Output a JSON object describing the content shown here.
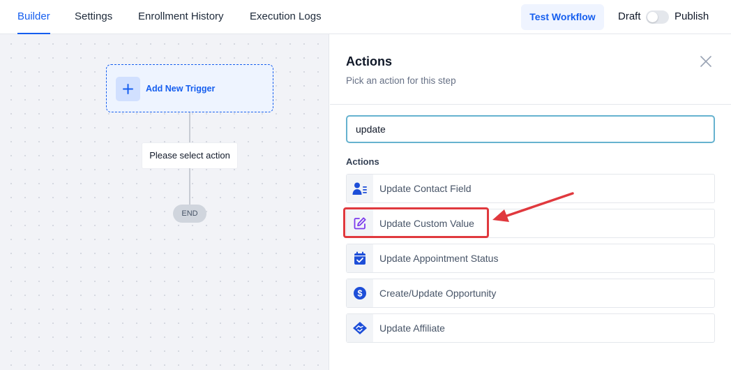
{
  "tabs": {
    "builder": "Builder",
    "settings": "Settings",
    "enrollment_history": "Enrollment History",
    "execution_logs": "Execution Logs"
  },
  "header": {
    "test_workflow": "Test Workflow",
    "draft": "Draft",
    "publish": "Publish",
    "publish_toggle_on": false
  },
  "canvas": {
    "add_trigger": "Add New Trigger",
    "select_action": "Please select action",
    "end": "END"
  },
  "panel": {
    "title": "Actions",
    "subtitle": "Pick an action for this step",
    "search_value": "update",
    "section_label": "Actions",
    "items": [
      {
        "label": "Update Contact Field",
        "icon": "contact-card-icon"
      },
      {
        "label": "Update Custom Value",
        "icon": "edit-pencil-icon"
      },
      {
        "label": "Update Appointment Status",
        "icon": "calendar-check-icon"
      },
      {
        "label": "Create/Update Opportunity",
        "icon": "dollar-circle-icon"
      },
      {
        "label": "Update Affiliate",
        "icon": "handshake-icon"
      }
    ]
  },
  "colors": {
    "accent": "#155eef",
    "icon_blue": "#1d4ed8",
    "icon_purple": "#7c3aed",
    "annotation_red": "#e0393e"
  }
}
